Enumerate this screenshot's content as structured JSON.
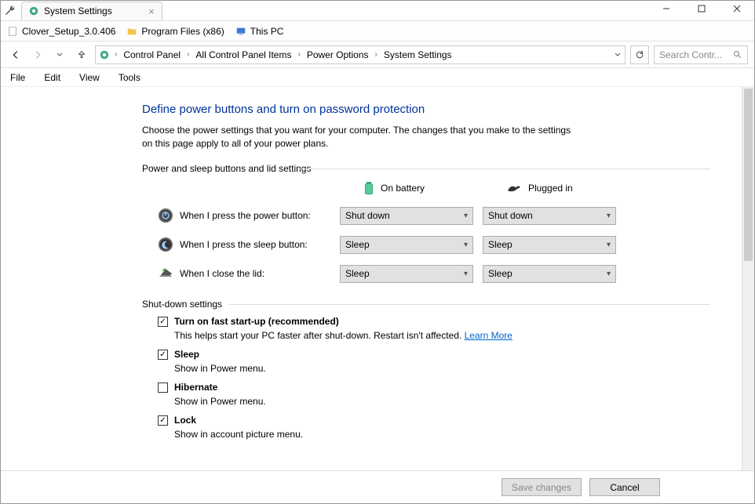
{
  "tab": {
    "title": "System Settings"
  },
  "bookmarks": [
    {
      "label": "Clover_Setup_3.0.406",
      "icon": "file"
    },
    {
      "label": "Program Files (x86)",
      "icon": "folder"
    },
    {
      "label": "This PC",
      "icon": "pc"
    }
  ],
  "breadcrumbs": [
    "Control Panel",
    "All Control Panel Items",
    "Power Options",
    "System Settings"
  ],
  "search": {
    "placeholder": "Search Contr..."
  },
  "menubar": [
    "File",
    "Edit",
    "View",
    "Tools"
  ],
  "page": {
    "heading": "Define power buttons and turn on password protection",
    "description": "Choose the power settings that you want for your computer. The changes that you make to the settings on this page apply to all of your power plans.",
    "section1": "Power and sleep buttons and lid settings",
    "columns": {
      "battery": "On battery",
      "plugged": "Plugged in"
    },
    "rows": [
      {
        "label": "When I press the power button:",
        "battery": "Shut down",
        "plugged": "Shut down"
      },
      {
        "label": "When I press the sleep button:",
        "battery": "Sleep",
        "plugged": "Sleep"
      },
      {
        "label": "When I close the lid:",
        "battery": "Sleep",
        "plugged": "Sleep"
      }
    ],
    "section2": "Shut-down settings",
    "shutdown": [
      {
        "checked": true,
        "label": "Turn on fast start-up (recommended)",
        "desc": "This helps start your PC faster after shut-down. Restart isn't affected. ",
        "link": "Learn More"
      },
      {
        "checked": true,
        "label": "Sleep",
        "desc": "Show in Power menu."
      },
      {
        "checked": false,
        "label": "Hibernate",
        "desc": "Show in Power menu."
      },
      {
        "checked": true,
        "label": "Lock",
        "desc": "Show in account picture menu."
      }
    ]
  },
  "footer": {
    "save": "Save changes",
    "cancel": "Cancel"
  }
}
